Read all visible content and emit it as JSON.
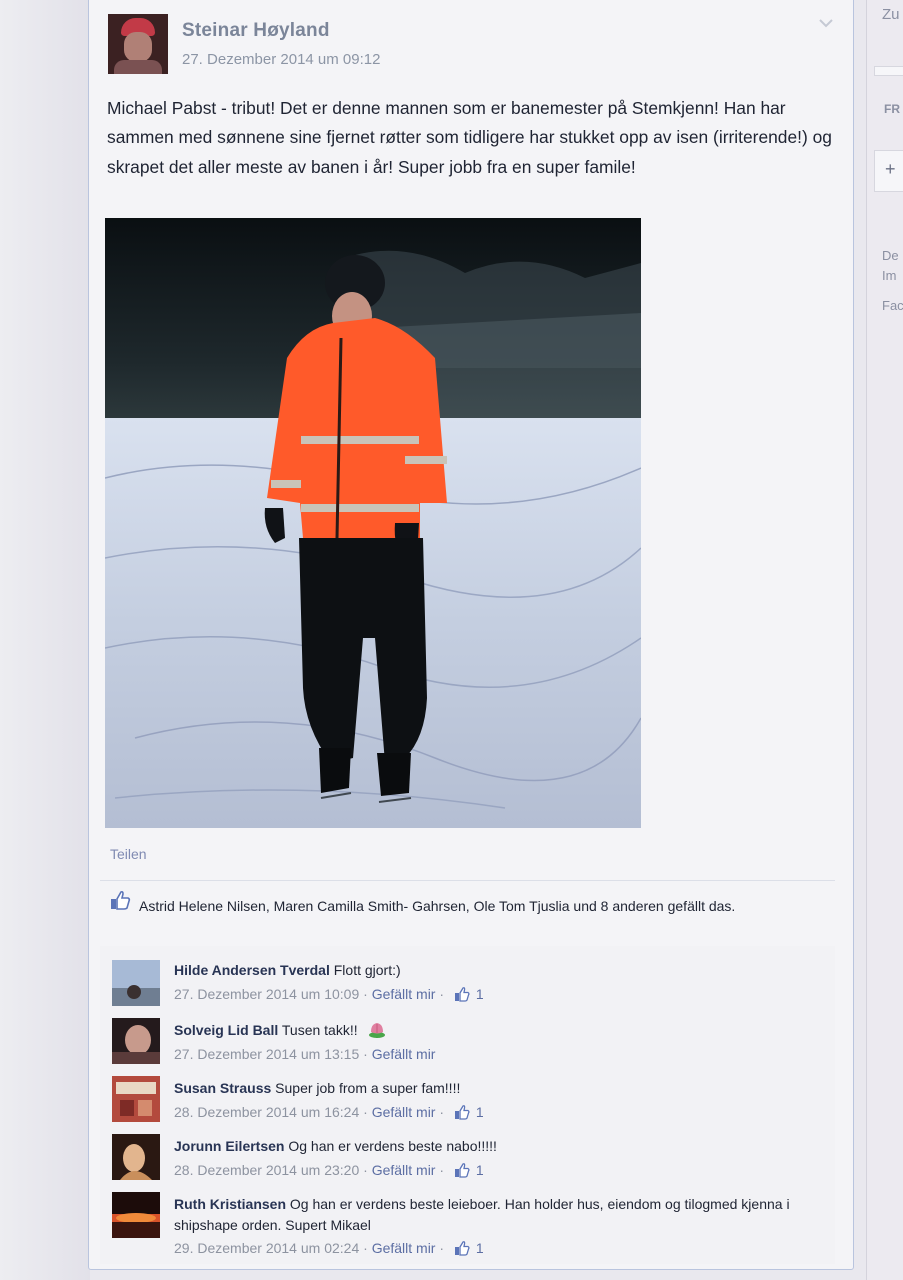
{
  "post": {
    "author": "Steinar Høyland",
    "timestamp": "27. Dezember 2014 um 09:12",
    "text": "Michael Pabst - tribut! Det er denne mannen som er banemester på Stemkjenn! Han har sammen med sønnene sine fjernet røtter som tidligere har stukket opp av isen (irriterende!) og skrapet det aller meste av banen i år! Super jobb fra en super famile!",
    "share_label": "Teilen",
    "likes_summary": "Astrid Helene Nilsen, Maren Camilla Smith- Gahrsen, Ole Tom Tjuslia und 8 anderen gefällt das."
  },
  "comments": [
    {
      "author": "Hilde Andersen Tverdal",
      "text": "Flott gjort:)",
      "time": "27. Dezember 2014 um 10:09",
      "sep1": "·",
      "like_label": "Gefällt mir",
      "sep2": "·",
      "likes": "1"
    },
    {
      "author": "Solveig Lid Ball",
      "text": "Tusen takk!!",
      "time": "27. Dezember 2014 um 13:15",
      "sep1": "·",
      "like_label": "Gefällt mir"
    },
    {
      "author": "Susan Strauss",
      "text": "Super job from a super fam!!!!",
      "time": "28. Dezember 2014 um 16:24",
      "sep1": "·",
      "like_label": "Gefällt mir",
      "sep2": "·",
      "likes": "1"
    },
    {
      "author": "Jorunn Eilertsen",
      "text": "Og han er verdens beste nabo!!!!!",
      "time": "28. Dezember 2014 um 23:20",
      "sep1": "·",
      "like_label": "Gefällt mir",
      "sep2": "·",
      "likes": "1"
    },
    {
      "author": "Ruth Kristiansen",
      "text": "Og han er verdens beste leieboer. Han holder hus, eiendom og tilogmed kjenna i shipshape orden. Supert Mikael",
      "time": "29. Dezember 2014 um 02:24",
      "sep1": "·",
      "like_label": "Gefällt mir",
      "sep2": "·",
      "likes": "1"
    }
  ],
  "sidebar": {
    "top": "Zu",
    "fr": "FR",
    "plus": "+",
    "line1": "De",
    "line2": "Im",
    "line3": "Fac"
  },
  "colors": {
    "link": "#5c6ea3",
    "author": "#283454",
    "jacket": "#ff5a2a"
  }
}
